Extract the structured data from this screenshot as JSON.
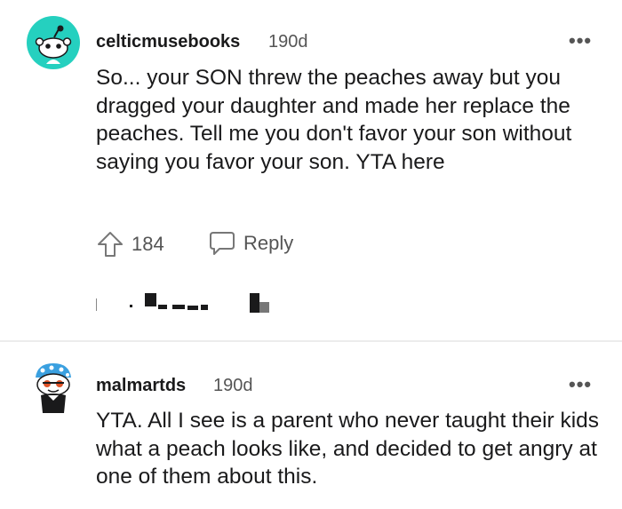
{
  "comments": [
    {
      "username": "celticmusebooks",
      "age": "190d",
      "text": "So... your SON threw the peaches away but you dragged your daughter and made her replace the peaches. Tell me you don't favor your son without saying you favor your son. YTA here",
      "upvotes": "184",
      "reply_label": "Reply",
      "more_label": "•••"
    },
    {
      "username": "malmartds",
      "age": "190d",
      "text": "YTA. All I see is a parent who never taught their kids what a peach looks like, and decided to get angry at one of them about this.",
      "more_label": "•••"
    }
  ],
  "colors": {
    "avatar_teal": "#25d0bf",
    "text": "#1a1a1b",
    "meta": "#555555"
  }
}
